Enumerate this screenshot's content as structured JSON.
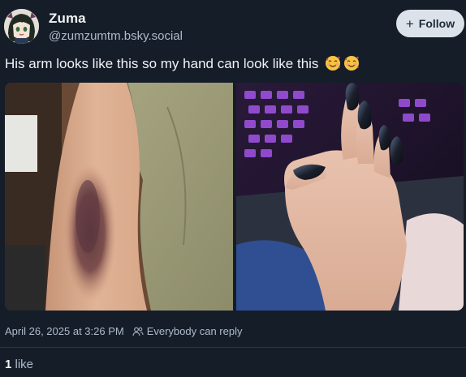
{
  "author": {
    "display_name": "Zuma",
    "handle": "@zumzumtm.bsky.social",
    "avatar": "anime-character-avatar"
  },
  "follow_button": {
    "label": "Follow",
    "icon": "plus-icon"
  },
  "post": {
    "text": "His arm looks like this so my hand can look like this",
    "emojis": [
      "smiling-face-with-hearts",
      "smiling-face-with-hearts"
    ],
    "images": [
      "bruised-forearm-photo",
      "painted-nails-hand-photo"
    ]
  },
  "meta": {
    "timestamp": "April 26, 2025 at 3:26 PM",
    "reply_setting": "Everybody can reply",
    "reply_icon": "people-icon"
  },
  "likes": {
    "count": "1",
    "label": "like"
  },
  "colors": {
    "background": "#151d28",
    "text": "#f1f3f5",
    "muted": "#aebbc9",
    "button_bg": "#dce2ea",
    "divider": "#2a3644"
  }
}
